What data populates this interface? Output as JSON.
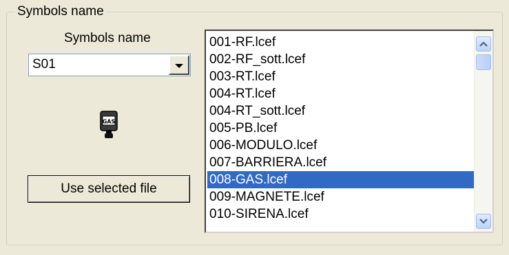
{
  "group": {
    "title": "Symbols name"
  },
  "left": {
    "label": "Symbols name",
    "combo_value": "S01",
    "preview_icon": "gas-symbol-icon",
    "preview_icon_text": "GAS",
    "button_label": "Use selected file"
  },
  "list": {
    "items": [
      "001-RF.lcef",
      "002-RF_sott.lcef",
      "003-RT.lcef",
      "004-RT.lcef",
      "004-RT_sott.lcef",
      "005-PB.lcef",
      "006-MODULO.lcef",
      "007-BARRIERA.lcef",
      "008-GAS.lcef",
      "009-MAGNETE.lcef",
      "010-SIRENA.lcef"
    ],
    "selected": "008-GAS.lcef"
  },
  "colors": {
    "selection": "#316ac5",
    "window_bg": "#ece9d8"
  }
}
